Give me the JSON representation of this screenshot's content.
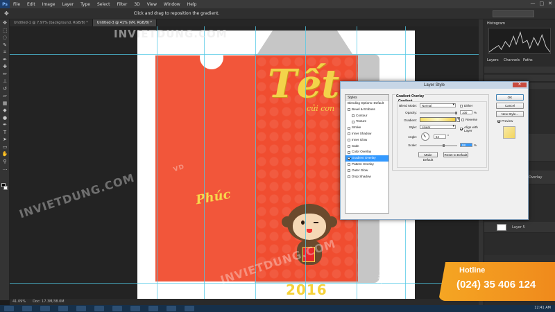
{
  "app": {
    "logo": "Ps",
    "menu": [
      "File",
      "Edit",
      "Image",
      "Layer",
      "Type",
      "Select",
      "Filter",
      "3D",
      "View",
      "Window",
      "Help"
    ],
    "window_controls": [
      "—",
      "□",
      "✕"
    ]
  },
  "options_bar": {
    "tip": "Click and drag to reposition the gradient."
  },
  "tabs": [
    {
      "label": "Untitled-1 @ 7.97% (background, RGB/8) *",
      "active": false
    },
    {
      "label": "Untitled-3 @ 41% (VR, RGB/8) *",
      "active": true
    }
  ],
  "canvas": {
    "tet_text": "Tết",
    "tet_sub": "cửi cơn",
    "phuc_text": "Phúc",
    "year_text": "2016",
    "watermark": "INVIETDUNG.COM",
    "watermark2": "INVIETDUNG",
    "wm_logo": "VD"
  },
  "status_bar": {
    "zoom": "41.09%",
    "doc": "Doc: 17.3M/38.0M"
  },
  "right_panel": {
    "histogram_label": "Histogram",
    "tabs": [
      "Layers",
      "Channels",
      "Paths"
    ],
    "layer_name": "Layer 5",
    "overlay_text": "Overlay",
    "layer_text_2": "nd"
  },
  "dialog": {
    "title": "Layer Style",
    "close": "✕",
    "styles_header": "Styles",
    "styles": [
      {
        "label": "Blending Options: Default",
        "checkbox": false,
        "checked": false,
        "indent": false,
        "selected": false
      },
      {
        "label": "Bevel & Emboss",
        "checkbox": true,
        "checked": false,
        "indent": false,
        "selected": false
      },
      {
        "label": "Contour",
        "checkbox": true,
        "checked": false,
        "indent": true,
        "selected": false
      },
      {
        "label": "Texture",
        "checkbox": true,
        "checked": false,
        "indent": true,
        "selected": false
      },
      {
        "label": "Stroke",
        "checkbox": true,
        "checked": false,
        "indent": false,
        "selected": false
      },
      {
        "label": "Inner Shadow",
        "checkbox": true,
        "checked": false,
        "indent": false,
        "selected": false
      },
      {
        "label": "Inner Glow",
        "checkbox": true,
        "checked": false,
        "indent": false,
        "selected": false
      },
      {
        "label": "Satin",
        "checkbox": true,
        "checked": false,
        "indent": false,
        "selected": false
      },
      {
        "label": "Color Overlay",
        "checkbox": true,
        "checked": false,
        "indent": false,
        "selected": false
      },
      {
        "label": "Gradient Overlay",
        "checkbox": true,
        "checked": true,
        "indent": false,
        "selected": true
      },
      {
        "label": "Pattern Overlay",
        "checkbox": true,
        "checked": false,
        "indent": false,
        "selected": false
      },
      {
        "label": "Outer Glow",
        "checkbox": true,
        "checked": false,
        "indent": false,
        "selected": false
      },
      {
        "label": "Drop Shadow",
        "checkbox": true,
        "checked": false,
        "indent": false,
        "selected": false
      }
    ],
    "gradient_overlay": {
      "section_title": "Gradient Overlay",
      "sub_title": "Gradient",
      "blend_mode_label": "Blend Mode:",
      "blend_mode_value": "Normal",
      "dither_label": "Dither",
      "opacity_label": "Opacity:",
      "opacity_value": "100",
      "opacity_fraction": 1.0,
      "percent": "%",
      "gradient_label": "Gradient:",
      "reverse_label": "Reverse",
      "style_label": "Style:",
      "style_value": "Linear",
      "align_label": "Align with Layer",
      "angle_label": "Angle:",
      "angle_value": "54",
      "degree": "°",
      "scale_label": "Scale:",
      "scale_value": "98",
      "scale_fraction": 0.65,
      "make_default": "Make Default",
      "reset_default": "Reset to Default"
    },
    "buttons": {
      "ok": "OK",
      "cancel": "Cancel",
      "new_style": "New Style...",
      "preview": "Preview"
    }
  },
  "hotline": {
    "label": "Hotline",
    "number": "(024) 35 406 124"
  },
  "taskbar": {
    "clock": "12:41 AM"
  }
}
